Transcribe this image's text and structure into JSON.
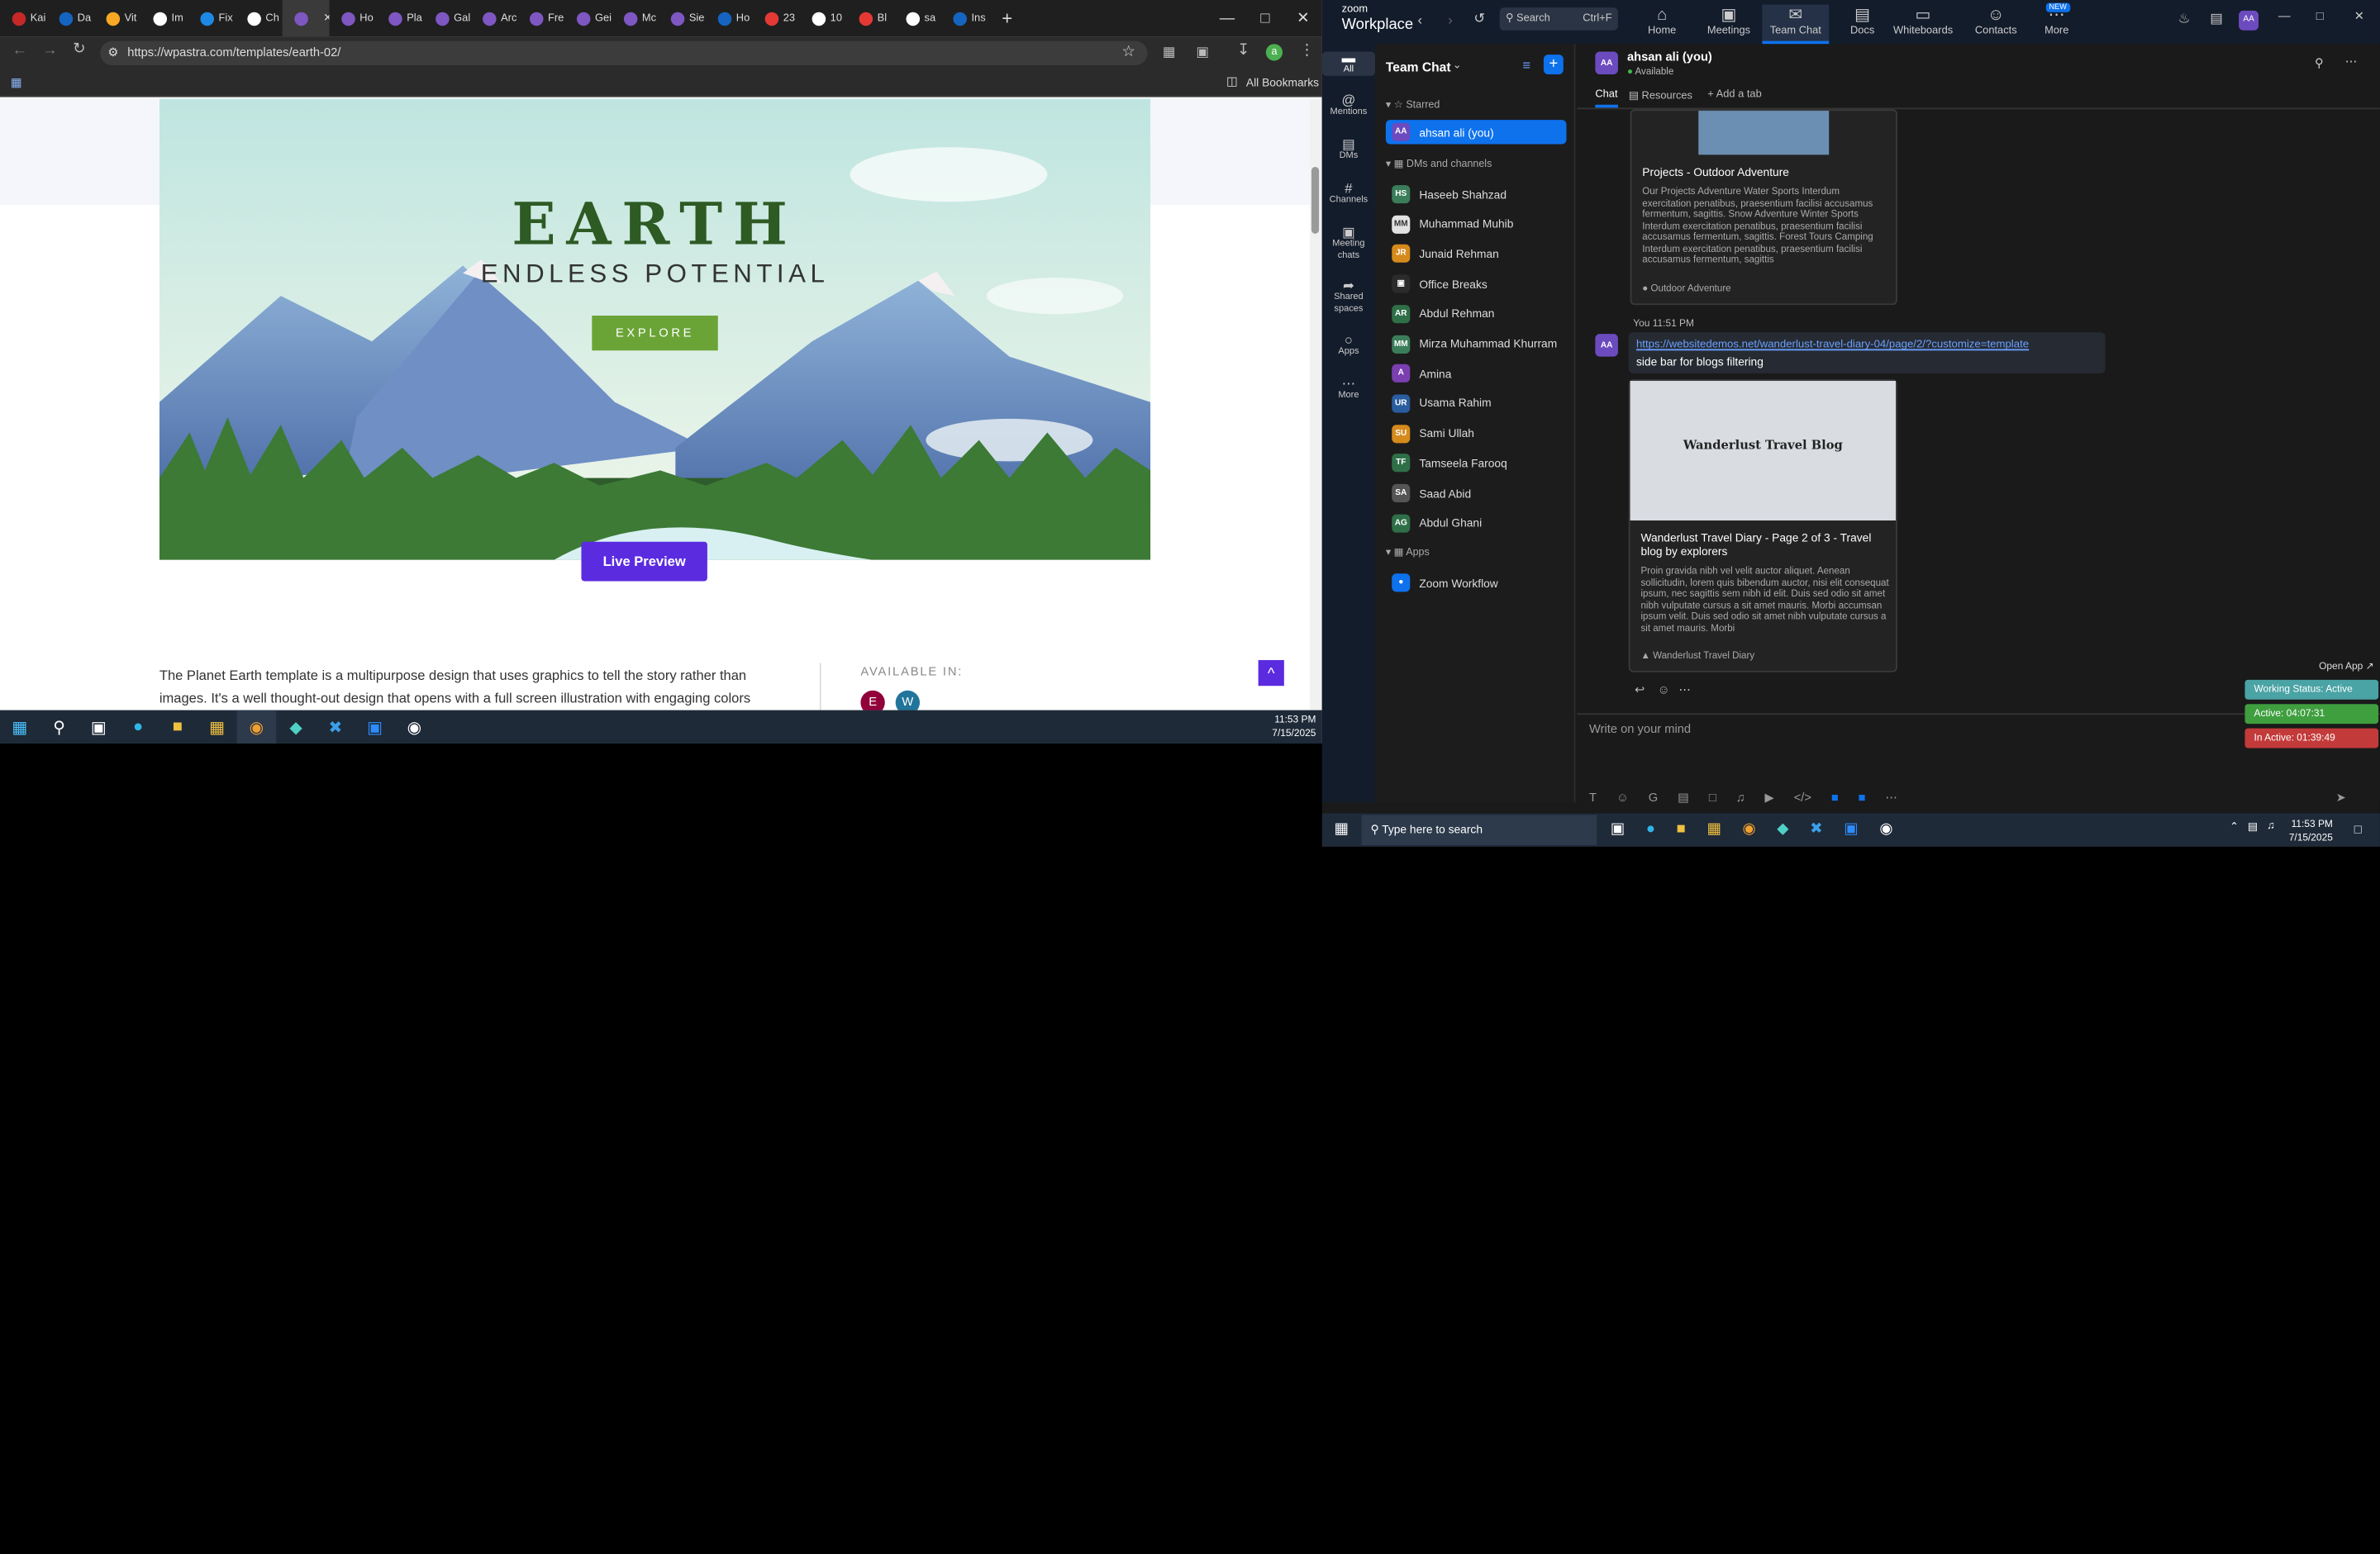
{
  "browser": {
    "tabs": [
      "Kai",
      "Da",
      "Vit",
      "Im",
      "Fix",
      "Ch",
      "",
      "Ho",
      "Pla",
      "Gal",
      "Arc",
      "Fre",
      "Gei",
      "Mc",
      "Sie",
      "Ho",
      "23",
      "10",
      "Bl",
      "sa",
      "Ins"
    ],
    "tab_colors": [
      "#c62828",
      "#1565c0",
      "#f9a825",
      "#ffffff",
      "#1e88e5",
      "#ffffff",
      "#7e57c2",
      "#7e57c2",
      "#7e57c2",
      "#7e57c2",
      "#7e57c2",
      "#7e57c2",
      "#7e57c2",
      "#7e57c2",
      "#7e57c2",
      "#1565c0",
      "#e53935",
      "#ffffff",
      "#e53935",
      "#ffffff",
      "#1565c0"
    ],
    "new_tab": "+",
    "url": "https://wpastra.com/templates/earth-02/",
    "all_bookmarks": "All Bookmarks",
    "profile_initial": "a"
  },
  "page": {
    "hero_title": "EARTH",
    "hero_subtitle": "ENDLESS POTENTIAL",
    "explore": "EXPLORE",
    "live_preview": "Live Preview",
    "description": "The Planet Earth template is a multipurpose design that uses graphics to tell the story rather than images. It's a well thought-out design that opens with a full screen illustration with engaging colors",
    "available_in": "AVAILABLE IN:",
    "scroll_top": "^",
    "accent_purple": "#5b2be0",
    "accent_green": "#6aa437"
  },
  "taskbar_left": {
    "time": "11:53 PM",
    "date": "7/15/2025"
  },
  "zoom": {
    "brand_line1": "zoom",
    "brand_line2": "Workplace",
    "search": "Search",
    "search_shortcut": "Ctrl+F",
    "nav": [
      "Home",
      "Meetings",
      "Team Chat",
      "Docs",
      "Whiteboards",
      "Contacts",
      "More"
    ],
    "new_badge": "NEW",
    "profile_initials": "AA",
    "rail": [
      "All",
      "Mentions",
      "DMs",
      "Channels",
      "Meeting chats",
      "Shared spaces",
      "Apps",
      "More"
    ],
    "list_title": "Team Chat",
    "starred_label": "Starred",
    "self_name": "ahsan ali (you)",
    "dm_label": "DMs and channels",
    "contacts": [
      {
        "init": "HS",
        "name": "Haseeb Shahzad",
        "color": "#3b7d5a"
      },
      {
        "init": "MM",
        "name": "Muhammad Muhib",
        "color": "#e2e2e2"
      },
      {
        "init": "JR",
        "name": "Junaid Rehman",
        "color": "#d58a1c"
      },
      {
        "init": "",
        "name": "Office Breaks",
        "color": "#2b2b2b"
      },
      {
        "init": "AR",
        "name": "Abdul Rehman",
        "color": "#2f6f48"
      },
      {
        "init": "MM",
        "name": "Mirza Muhammad Khurram",
        "color": "#3b7d5a"
      },
      {
        "init": "A",
        "name": "Amina",
        "color": "#7b3fb0"
      },
      {
        "init": "UR",
        "name": "Usama Rahim",
        "color": "#2a5d9f"
      },
      {
        "init": "SU",
        "name": "Sami Ullah",
        "color": "#d58a1c"
      },
      {
        "init": "TF",
        "name": "Tamseela Farooq",
        "color": "#2f6f48"
      },
      {
        "init": "SA",
        "name": "Saad Abid",
        "color": "#555555"
      },
      {
        "init": "AG",
        "name": "Abdul Ghani",
        "color": "#2f6f48"
      }
    ],
    "apps_label": "Apps",
    "app_item": "Zoom Workflow",
    "chat_name": "ahsan ali (you)",
    "chat_status": "Available",
    "chat_tabs": [
      "Chat",
      "Resources",
      "Add a tab"
    ],
    "card1_title": "Projects - Outdoor Adventure",
    "card1_body": "Our Projects Adventure Water Sports Interdum exercitation penatibus, praesentium facilisi accusamus fermentum, sagittis. Snow Adventure Winter Sports Interdum exercitation penatibus, praesentium facilisi accusamus fermentum, sagittis. Forest Tours Camping Interdum exercitation penatibus, praesentium facilisi accusamus fermentum, sagittis",
    "card1_source": "Outdoor Adventure",
    "msg_meta": "You 11:51 PM",
    "msg_link": "https://websitedemos.net/wanderlust-travel-diary-04/page/2/?customize=template",
    "msg_text": "side bar for blogs filtering",
    "preview_heading": "Wanderlust Travel Blog",
    "card2_title": "Wanderlust Travel Diary - Page 2 of 3 - Travel blog by explorers",
    "card2_body": "Proin gravida nibh vel velit auctor aliquet. Aenean sollicitudin, lorem quis bibendum auctor, nisi elit consequat ipsum, nec sagittis sem nibh id elit. Duis sed odio sit amet nibh vulputate cursus a sit amet mauris. Morbi accumsan ipsum velit. Duis sed odio sit amet nibh vulputate cursus a sit amet mauris. Morbi",
    "card2_source": "Wanderlust Travel Diary",
    "composer_placeholder": "Write on your mind",
    "open_app": "Open App",
    "working_status": "Working Status: Active",
    "active": "Active: 04:07:31",
    "inactive": "In Active: 01:39:49",
    "search_placeholder": "Type here to search",
    "time": "11:53 PM",
    "date": "7/15/2025"
  }
}
